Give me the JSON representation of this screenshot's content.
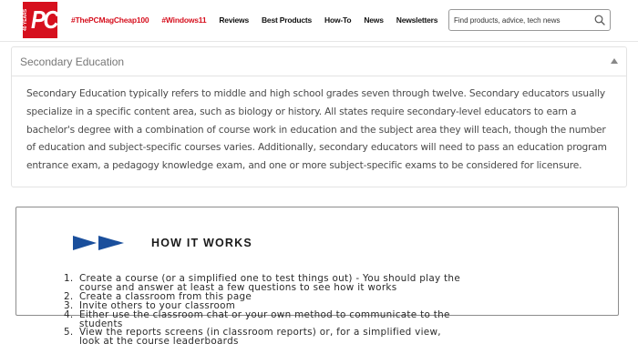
{
  "logo": {
    "years": "40 YEARS",
    "brand": "PC"
  },
  "nav": {
    "items": [
      {
        "label": "#ThePCMagCheap100",
        "hot": true
      },
      {
        "label": "#Windows11",
        "hot": true
      },
      {
        "label": "Reviews",
        "hot": false
      },
      {
        "label": "Best Products",
        "hot": false
      },
      {
        "label": "How-To",
        "hot": false
      },
      {
        "label": "News",
        "hot": false
      },
      {
        "label": "Newsletters",
        "hot": false
      }
    ]
  },
  "search": {
    "placeholder": "Find products, advice, tech news",
    "icon": "search-icon"
  },
  "accordion": {
    "title": "Secondary Education",
    "expanded": true,
    "caret_icon": "caret-up-icon",
    "body_lines": [
      "Secondary Education typically refers to middle and high school grades seven through twelve. Secondary educators usually",
      "specialize in a specific content area, such as biology or history. All states require secondary-level educators to earn a",
      "bachelor's degree with a combination of course work in education and the subject area they will teach, though the number",
      "of education and subject-specific courses varies. Additionally, secondary educators will need to pass an education program",
      "entrance exam, a pedagogy knowledge exam, and one or more subject-specific exams to be considered for licensure."
    ]
  },
  "how_it_works": {
    "heading": "HOW IT WORKS",
    "arrow_icon": "double-arrow-icon",
    "steps": [
      {
        "num": "1.",
        "lines": [
          "Create a course (or a simplified one to test things out) - You should play the",
          "course and answer at least a few questions to see how it works"
        ]
      },
      {
        "num": "2.",
        "lines": [
          "Create a classroom from this page"
        ]
      },
      {
        "num": "3.",
        "lines": [
          "Invite others to your classroom"
        ]
      },
      {
        "num": "4.",
        "lines": [
          "Either use the classroom chat or your own method to communicate to the",
          "students"
        ]
      },
      {
        "num": "5.",
        "lines": [
          "View the reports screens (in classroom reports) or, for a simplified view,",
          "look at the course leaderboards"
        ]
      }
    ]
  },
  "colors": {
    "brand_red": "#d6101e",
    "arrow_blue": "#1a4f9c"
  }
}
